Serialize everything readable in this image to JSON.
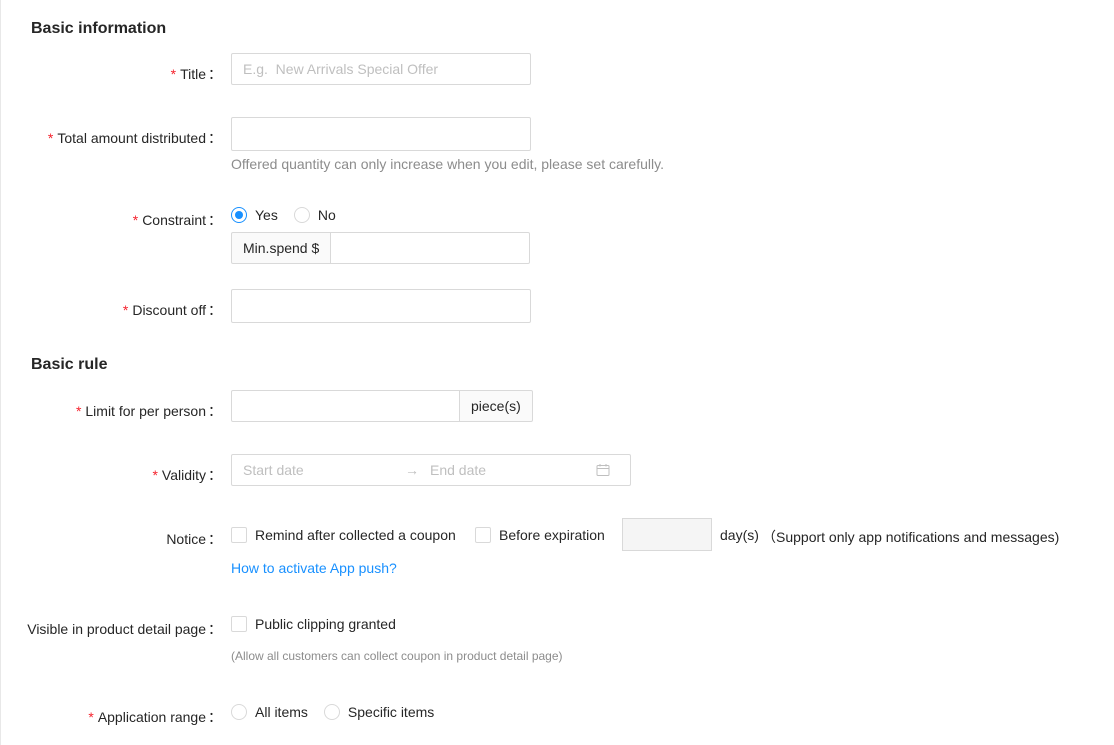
{
  "sections": {
    "basic_info": "Basic information",
    "basic_rule": "Basic rule"
  },
  "fields": {
    "title": {
      "label": "Title",
      "placeholder": "E.g.  New Arrivals Special Offer"
    },
    "total_amount": {
      "label": "Total amount distributed",
      "hint": "Offered quantity can only increase when you edit, please set carefully."
    },
    "constraint": {
      "label": "Constraint",
      "yes": "Yes",
      "no": "No",
      "selected": "Yes",
      "min_spend_prefix": "Min.spend $"
    },
    "discount_off": {
      "label": "Discount off"
    },
    "limit_per_person": {
      "label": "Limit for per person",
      "suffix": "piece(s)"
    },
    "validity": {
      "label": "Validity",
      "start_placeholder": "Start date",
      "end_placeholder": "End date"
    },
    "notice": {
      "label": "Notice",
      "remind_option": "Remind after collected a coupon",
      "before_expiration": "Before expiration",
      "days_unit": "day(s)",
      "support_note": "（Support only app notifications and messages)",
      "link": "How to activate App push?"
    },
    "visible_detail": {
      "label": "Visible in product detail page",
      "option": "Public clipping granted",
      "hint": "(Allow all customers can collect coupon in product detail page)"
    },
    "application_range": {
      "label": "Application range",
      "all": "All items",
      "specific": "Specific items"
    }
  },
  "colors": {
    "required": "#f5222d",
    "primary": "#1890ff",
    "border": "#d9d9d9"
  },
  "separators": {
    "colon": "：",
    "arrow": "→"
  }
}
